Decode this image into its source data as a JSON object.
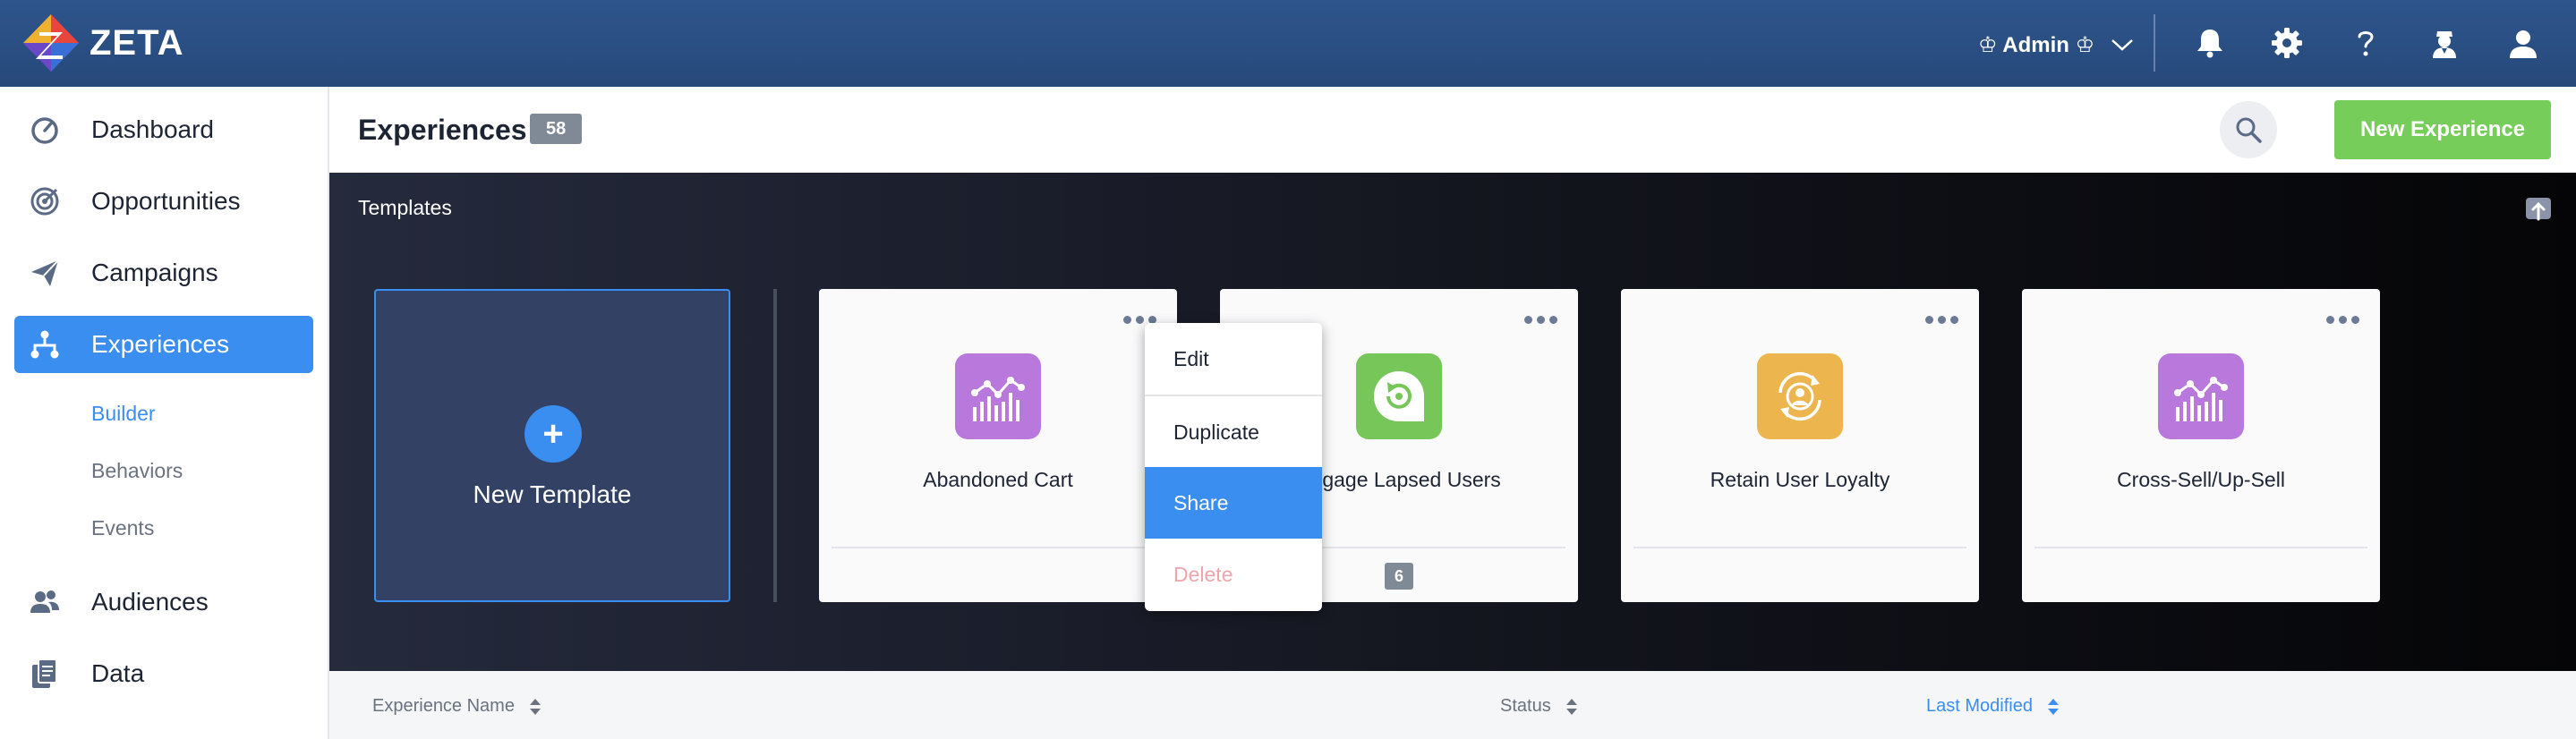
{
  "app": {
    "brand": "ZETA",
    "user_menu_label": "♔ Admin ♔",
    "colors": {
      "topbar": "#2d558c",
      "accent": "#3a8ef0",
      "success": "#76cd5a",
      "danger_muted": "#f0a4ab"
    },
    "top_icons": [
      "bell-icon",
      "gear-icon",
      "help-icon",
      "agent-icon",
      "user-icon"
    ]
  },
  "sidebar": {
    "items": [
      {
        "label": "Dashboard",
        "icon": "gauge-icon"
      },
      {
        "label": "Opportunities",
        "icon": "target-icon"
      },
      {
        "label": "Campaigns",
        "icon": "paper-plane-icon"
      },
      {
        "label": "Experiences",
        "icon": "hierarchy-icon",
        "active": true
      },
      {
        "label": "Audiences",
        "icon": "users-icon"
      },
      {
        "label": "Data",
        "icon": "files-icon"
      }
    ],
    "subitems": [
      {
        "label": "Builder",
        "active": true
      },
      {
        "label": "Behaviors"
      },
      {
        "label": "Events"
      }
    ]
  },
  "header": {
    "title": "Experiences",
    "count": "58",
    "new_button": "New Experience"
  },
  "templates": {
    "title": "Templates",
    "new_template_label": "New Template",
    "cards": [
      {
        "title": "Abandoned Cart",
        "icon": "analytics-chart-icon",
        "icon_color": "#b979dc"
      },
      {
        "title": "Engage Lapsed Users",
        "icon": "refresh-chat-icon",
        "icon_color": "#77c659",
        "count": "6"
      },
      {
        "title": "Retain User Loyalty",
        "icon": "user-cycle-icon",
        "icon_color": "#ecb54e"
      },
      {
        "title": "Cross-Sell/Up-Sell",
        "icon": "analytics-chart-icon",
        "icon_color": "#b979dc"
      }
    ]
  },
  "context_menu": {
    "items": [
      {
        "label": "Edit"
      },
      {
        "label": "Duplicate"
      },
      {
        "label": "Share",
        "active": true
      },
      {
        "label": "Delete",
        "disabled": true
      }
    ]
  },
  "table": {
    "columns": [
      {
        "label": "Experience Name"
      },
      {
        "label": "Status"
      },
      {
        "label": "Last Modified",
        "active": true
      }
    ]
  }
}
